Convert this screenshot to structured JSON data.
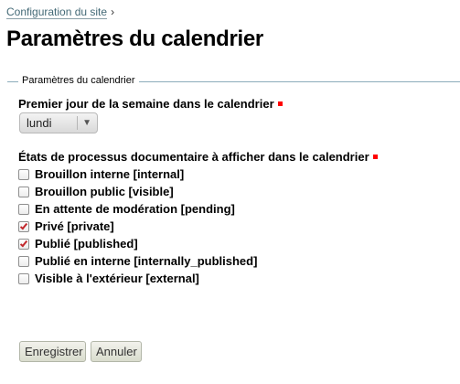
{
  "breadcrumb": {
    "link_label": "Configuration du site",
    "separator": "›"
  },
  "page": {
    "title": "Paramètres du calendrier"
  },
  "fieldset": {
    "legend": "Paramètres du calendrier"
  },
  "first_day": {
    "label": "Premier jour de la semaine dans le calendrier",
    "selected_value": "lundi"
  },
  "states": {
    "label": "États de processus documentaire à afficher dans le calendrier",
    "options": [
      {
        "label": "Brouillon interne [internal]",
        "checked": false
      },
      {
        "label": "Brouillon public [visible]",
        "checked": false
      },
      {
        "label": "En attente de modération [pending]",
        "checked": false
      },
      {
        "label": "Privé [private]",
        "checked": true
      },
      {
        "label": "Publié [published]",
        "checked": true
      },
      {
        "label": "Publié en interne [internally_published]",
        "checked": false
      },
      {
        "label": "Visible à l'extérieur [external]",
        "checked": false
      }
    ]
  },
  "actions": {
    "save_label": "Enregistrer",
    "cancel_label": "Annuler"
  },
  "colors": {
    "link": "#436976",
    "required": "#ff0000",
    "check_mark": "#c2282c",
    "fieldset_rule": "#8cacbb"
  }
}
